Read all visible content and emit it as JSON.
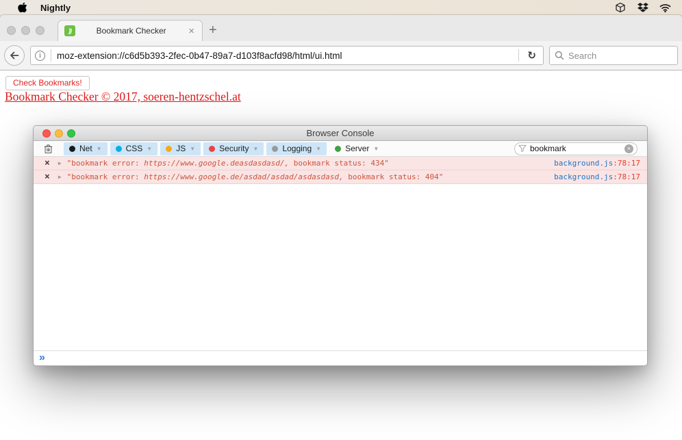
{
  "menubar": {
    "app_name": "Nightly",
    "tray_icons": [
      "cube-icon",
      "dropbox-icon",
      "wifi-icon"
    ]
  },
  "browser": {
    "tab": {
      "title": "Bookmark Checker",
      "close_glyph": "×",
      "new_tab_glyph": "+",
      "favicon_glyph": "))"
    },
    "nav": {
      "url": "moz-extension://c6d5b393-2fec-0b47-89a7-d103f8acfd98/html/ui.html",
      "reload_glyph": "↻",
      "info_glyph": "i",
      "search_placeholder": "Search"
    },
    "page": {
      "check_button": "Check Bookmarks!",
      "footer_link": "Bookmark Checker © 2017, soeren-hentzschel.at",
      "accent_red": "#e32222"
    }
  },
  "console": {
    "title": "Browser Console",
    "filters": [
      {
        "label": "Net",
        "dot_color": "#1a1a1a",
        "active": true
      },
      {
        "label": "CSS",
        "dot_color": "#00b0e8",
        "active": true
      },
      {
        "label": "JS",
        "dot_color": "#f5a91e",
        "active": true
      },
      {
        "label": "Security",
        "dot_color": "#eb4341",
        "active": true
      },
      {
        "label": "Logging",
        "dot_color": "#9a9a9a",
        "active": true
      },
      {
        "label": "Server",
        "dot_color": "#3fa23f",
        "active": false
      }
    ],
    "filter_input": {
      "value": "bookmark",
      "clear_glyph": "×"
    },
    "messages": [
      {
        "close_glyph": "×",
        "text_open": "\"bookmark error: ",
        "url": "https://www.google.deasdasdasd/,",
        "text_close": " bookmark status: 434\"",
        "source_file": "background.js",
        "source_pos": ":78:17"
      },
      {
        "close_glyph": "×",
        "text_open": "\"bookmark error: ",
        "url": "https://www.google.de/asdad/asdad/asdasdasd,",
        "text_close": " bookmark status: 404\"",
        "source_file": "background.js",
        "source_pos": ":78:17"
      }
    ],
    "prompt_glyph": "»",
    "colors": {
      "error_row_bg": "#fae4e4",
      "error_text": "#ca553c",
      "frame_file_blue": "#2176c7",
      "frame_pos_red": "#e3402c",
      "filter_active_bg": "#cde5f7"
    }
  }
}
